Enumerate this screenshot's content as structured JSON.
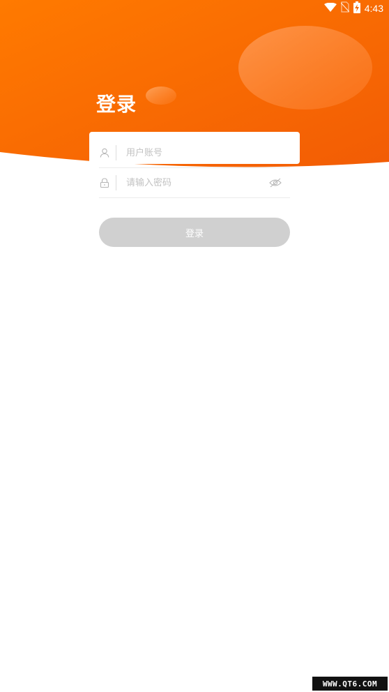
{
  "status_bar": {
    "time": "4:43",
    "icons": [
      "wifi-icon",
      "no-sim-icon",
      "battery-charging-icon"
    ]
  },
  "page": {
    "title": "登录"
  },
  "form": {
    "username_placeholder": "用户账号",
    "password_placeholder": "请输入密码",
    "username_value": "",
    "password_value": "",
    "user_icon": "user-icon",
    "lock_icon": "lock-icon",
    "visibility_icon": "eye-off-icon"
  },
  "actions": {
    "login_label": "登录"
  },
  "watermark": {
    "text": "WWW.QT6.COM"
  },
  "colors": {
    "brand_orange": "#FF7A00",
    "brand_orange_dark": "#F25C05",
    "button_disabled": "#D0D0D0",
    "placeholder": "#C2C2C2",
    "divider": "#EBEBEB"
  }
}
